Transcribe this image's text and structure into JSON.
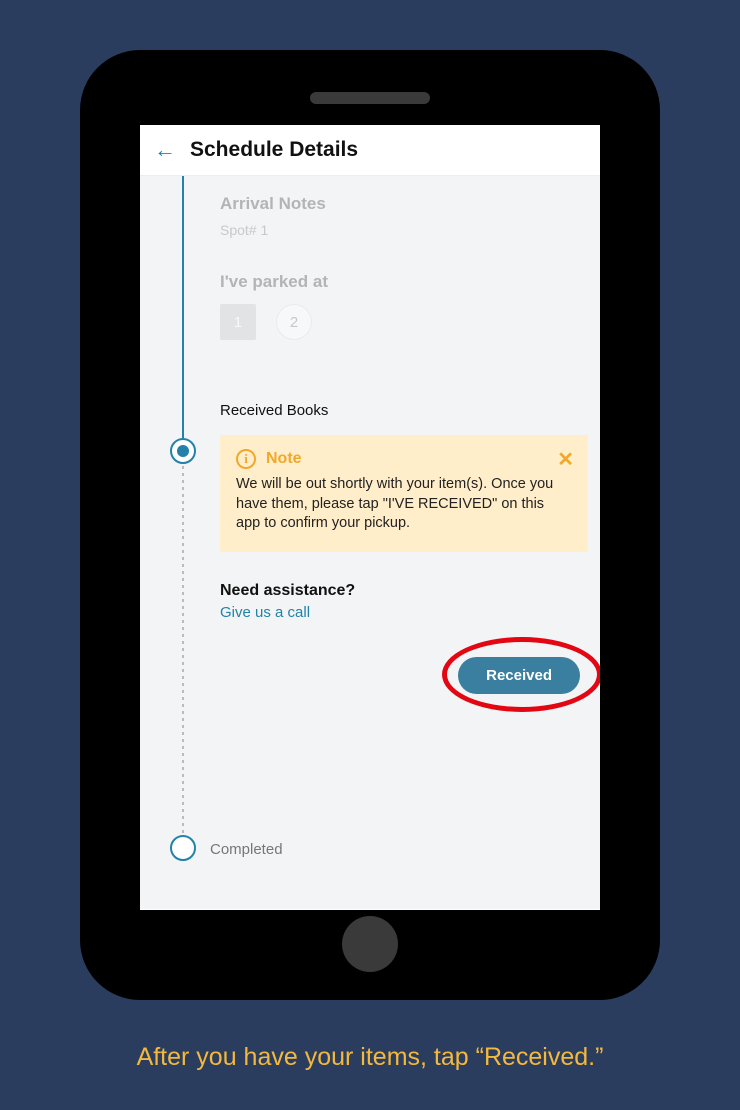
{
  "header": {
    "title": "Schedule Details"
  },
  "arrival": {
    "title": "Arrival Notes",
    "spot": "Spot# 1",
    "parked_label": "I've parked at",
    "options": {
      "opt1": "1",
      "opt2": "2"
    }
  },
  "received": {
    "step_label": "Received Books",
    "note_title": "Note",
    "note_body": "We will be out shortly with your item(s). Once you have them, please tap \"I'VE RECEIVED\" on this app to confirm your pickup.",
    "assist_title": "Need assistance?",
    "assist_link": "Give us a call",
    "button_label": "Received"
  },
  "completed": {
    "label": "Completed"
  },
  "caption": "After you have your items, tap “Received.”"
}
